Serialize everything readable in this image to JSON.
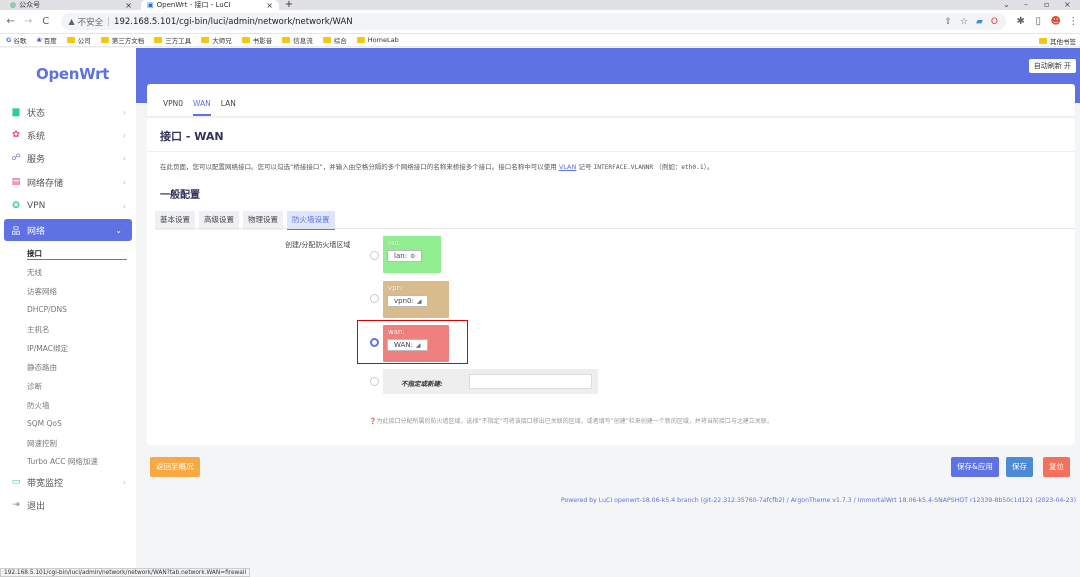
{
  "browser": {
    "tabs": [
      {
        "title": "公众号"
      },
      {
        "title": "OpenWrt - 接口 - LuCI"
      }
    ],
    "address": {
      "insecure_label": "不安全",
      "url": "192.168.5.101/cgi-bin/luci/admin/network/network/WAN"
    },
    "bookmarks": [
      "谷歌",
      "百度",
      "公司",
      "第三方文档",
      "三方工具",
      "大师兄",
      "书影音",
      "信息流",
      "综合",
      "HomeLab"
    ],
    "bookmarks_right": "其他书签",
    "status_url": "192.168.5.101/cgi-bin/luci/admin/network/network/WAN?tab.network.WAN=firewall"
  },
  "sidebar": {
    "logo": "OpenWrt",
    "menu": [
      {
        "label": "状态",
        "icon": "dashboard-icon"
      },
      {
        "label": "系统",
        "icon": "gear-icon"
      },
      {
        "label": "服务",
        "icon": "share-icon"
      },
      {
        "label": "网络存储",
        "icon": "storage-icon"
      },
      {
        "label": "VPN",
        "icon": "vpn-icon"
      },
      {
        "label": "网络",
        "icon": "network-icon"
      }
    ],
    "network_sub": [
      "接口",
      "无线",
      "访客网络",
      "DHCP/DNS",
      "主机名",
      "IP/MAC绑定",
      "静态路由",
      "诊断",
      "防火墙",
      "SQM QoS",
      "网速控制",
      "Turbo ACC 网络加速"
    ],
    "bottom_menu": [
      {
        "label": "带宽监控",
        "icon": "monitor-icon"
      },
      {
        "label": "退出",
        "icon": "logout-icon"
      }
    ]
  },
  "header": {
    "auto_refresh": "自动刷新 开"
  },
  "iface_tabs": [
    "VPN0",
    "WAN",
    "LAN"
  ],
  "page": {
    "title": "接口 - WAN",
    "desc_before": "在此页面，您可以配置网络接口。您可以勾选“桥接接口”，并输入由空格分隔的多个网络接口的名称来桥接多个接口。接口名称中可以使用",
    "desc_link": "VLAN",
    "desc_mid": "记号",
    "desc_mono": "INTERFACE.VLANNR",
    "desc_after": "（例如：",
    "desc_mono2": "eth0.1",
    "desc_end": "）。",
    "section_title": "一般配置",
    "subtabs": [
      "基本设置",
      "高级设置",
      "物理设置",
      "防火墙设置"
    ],
    "zone_field_label": "创建/分配防火墙区域",
    "zones": [
      {
        "name": "lan:",
        "iface": "lan:",
        "color": "#90ee90"
      },
      {
        "name": "vpn:",
        "iface": "vpn0:",
        "color": "#d8bc8e"
      },
      {
        "name": "wan:",
        "iface": "WAN:",
        "color": "#f08080"
      }
    ],
    "unspecified_label": "不指定或新建:",
    "hint": "为此接口分配所属的防火墙区域，选择“不指定”可将该接口移出已关联的区域，或者填写“创建”栏来创建一个新的区域，并将当前接口与之建立关联。"
  },
  "actions": {
    "back": "返回至概况",
    "save_apply": "保存&应用",
    "save": "保存",
    "reset": "复位"
  },
  "footer": {
    "text": "Powered by LuCI openwrt-18.06-k5.4 branch (git-22.312.35760-7afcfb2) / ArgonTheme v1.7.3 / ImmortalWrt 18.06-k5.4-SNAPSHOT r12339-8b50c1d121 (2023-04-23)"
  }
}
